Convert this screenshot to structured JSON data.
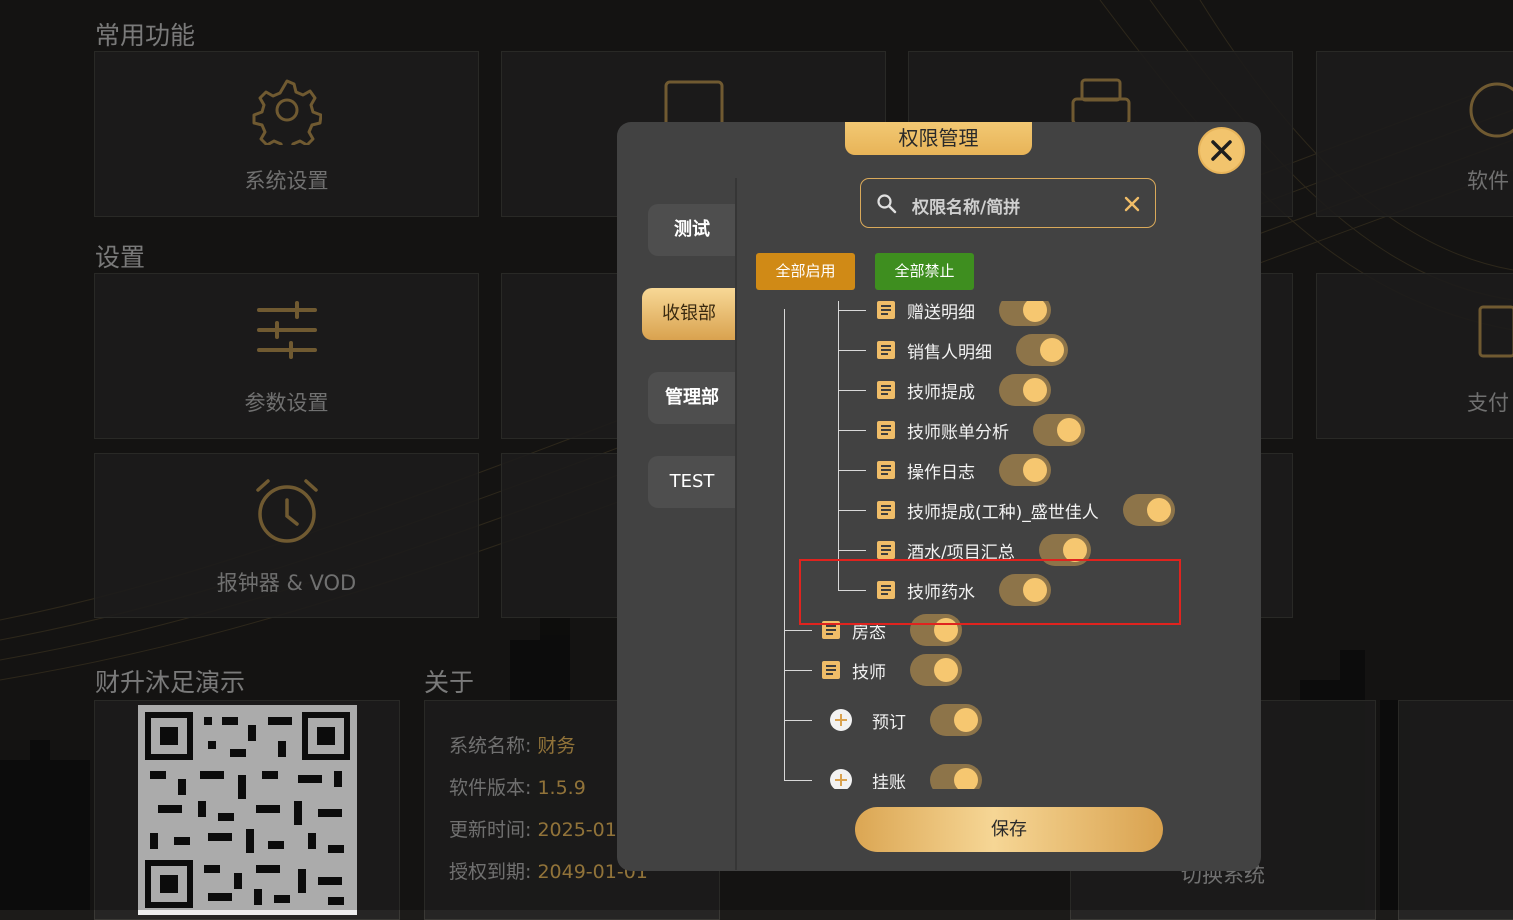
{
  "background": {
    "sections": {
      "common": "常用功能",
      "settings": "设置",
      "store": "财升沐足演示",
      "about": "关于"
    },
    "tiles": {
      "system_settings": "系统设置",
      "software_partial": "软件",
      "param_settings": "参数设置",
      "payment_partial": "支付",
      "alarm": "报钟器 & VOD",
      "switch_system": "切换系统"
    },
    "about": {
      "system_name_label": "系统名称:",
      "system_name_value": "财务",
      "version_label": "软件版本:",
      "version_value": "1.5.9",
      "update_label": "更新时间:",
      "update_value": "2025-01",
      "expire_label": "授权到期:",
      "expire_value": "2049-01-01"
    }
  },
  "modal": {
    "title": "权限管理",
    "tabs": [
      "测试",
      "收银部",
      "管理部",
      "TEST"
    ],
    "active_tab": "收银部",
    "search_placeholder": "权限名称/简拼",
    "enable_all": "全部启用",
    "disable_all": "全部禁止",
    "tree": {
      "child_items": [
        {
          "label": "赠送明细",
          "on": true
        },
        {
          "label": "销售人明细",
          "on": true
        },
        {
          "label": "技师提成",
          "on": true
        },
        {
          "label": "技师账单分析",
          "on": true
        },
        {
          "label": "操作日志",
          "on": true
        },
        {
          "label": "技师提成(工种)_盛世佳人",
          "on": true
        },
        {
          "label": "酒水/项目汇总",
          "on": true
        },
        {
          "label": "技师药水",
          "on": true
        }
      ],
      "top_items": [
        {
          "label": "房态",
          "on": true,
          "icon": "doc-icon"
        },
        {
          "label": "技师",
          "on": true,
          "icon": "doc-icon"
        },
        {
          "label": "预订",
          "on": true,
          "icon": "plus-icon"
        },
        {
          "label": "挂账",
          "on": true,
          "icon": "plus-icon"
        }
      ]
    },
    "save": "保存"
  },
  "colors": {
    "accent": "#f2c46d",
    "enable_bg": "#d08a16",
    "disable_bg": "#3e8e1f",
    "highlight": "#e0231e"
  }
}
